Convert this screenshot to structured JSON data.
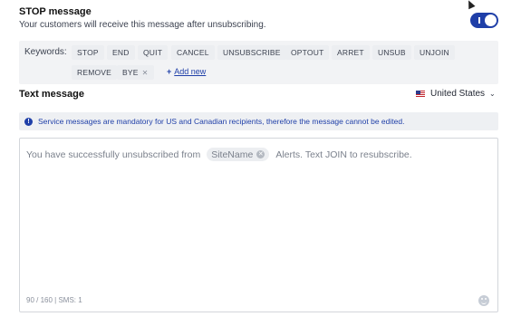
{
  "header": {
    "title": "STOP message",
    "subtitle": "Your customers will receive this message after unsubscribing."
  },
  "toggle": {
    "state": "on",
    "label": "I"
  },
  "keywords": {
    "label": "Keywords:",
    "items": [
      "STOP",
      "END",
      "QUIT",
      "CANCEL",
      "UNSUBSCRIBE",
      "OPTOUT",
      "ARRET",
      "UNSUB",
      "UNJOIN",
      "REMOVE",
      "BYE"
    ],
    "add_new": "Add new"
  },
  "text_message": {
    "title": "Text message",
    "country": "United States"
  },
  "info_banner": {
    "text": "Service messages are mandatory for US and Canadian recipients, therefore the message cannot be edited."
  },
  "message": {
    "before": "You have successfully unsubscribed from",
    "variable": "SiteName",
    "after": "Alerts. Text JOIN to resubscribe.",
    "counter": "90 / 160  |  SMS: 1"
  },
  "colors": {
    "accent": "#1f3fa8",
    "panel_bg": "#f2f3f5",
    "muted_text": "#7b818c"
  }
}
